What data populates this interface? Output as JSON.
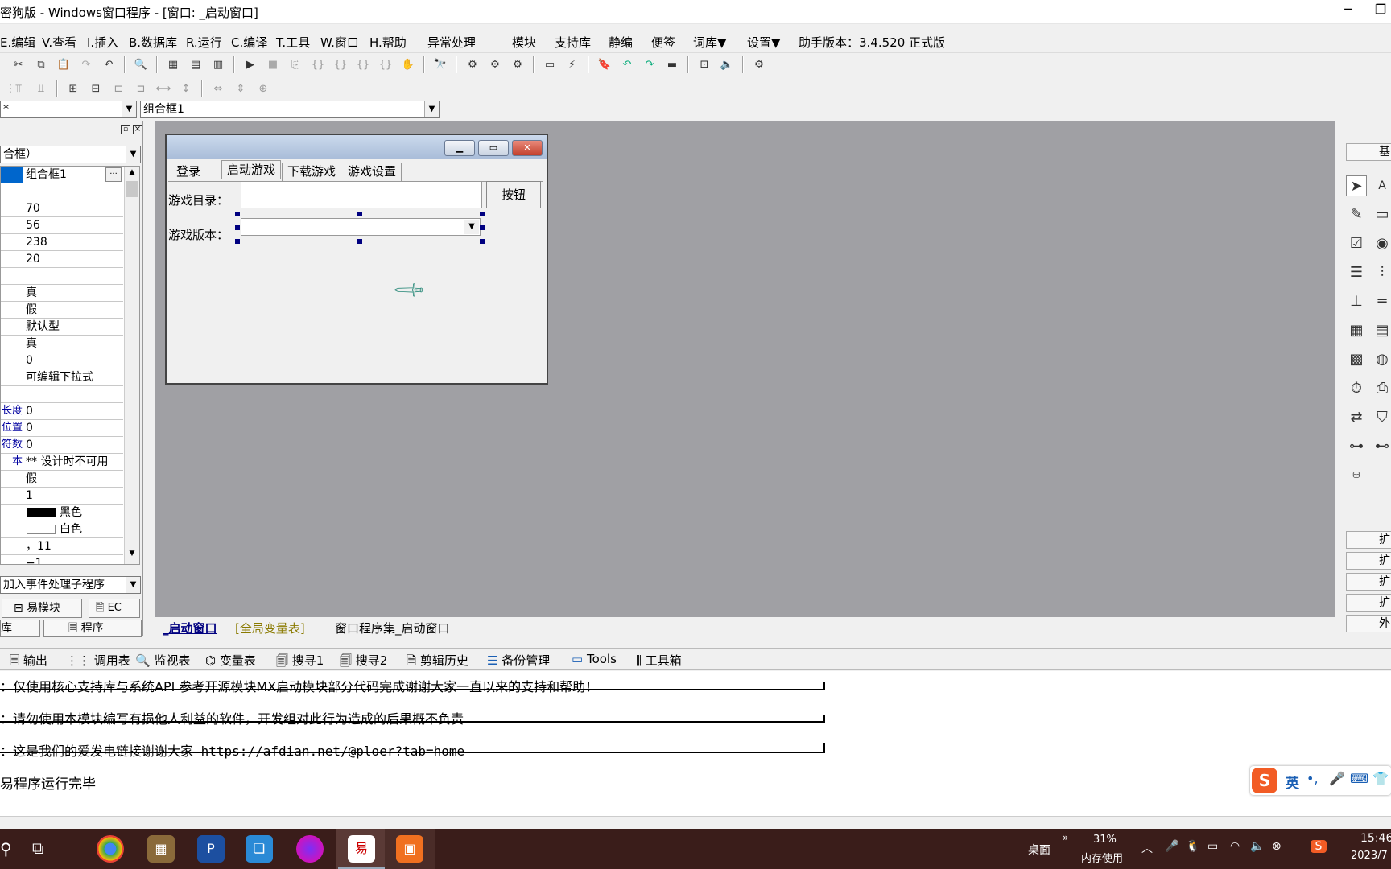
{
  "window": {
    "title": "密狗版 - Windows窗口程序 - [窗口: _启动窗口]",
    "min_icon": "minimize-icon",
    "max_icon": "restore-icon"
  },
  "menu": {
    "items": [
      "E.编辑",
      "V.查看",
      "I.插入",
      "B.数据库",
      "R.运行",
      "C.编译",
      "T.工具",
      "W.窗口",
      "H.帮助",
      "异常处理",
      "模块",
      "支持库",
      "静编",
      "便签",
      "词库▼",
      "设置▼"
    ],
    "version": "助手版本：3.4.520 正式版"
  },
  "toolbar": {
    "combo1": "*",
    "combo2": "组合框1"
  },
  "props": {
    "header": "合框）",
    "rows": [
      {
        "k": "",
        "v": "组合框1"
      },
      {
        "k": "",
        "v": ""
      },
      {
        "k": "",
        "v": "70"
      },
      {
        "k": "",
        "v": "56"
      },
      {
        "k": "",
        "v": "238"
      },
      {
        "k": "",
        "v": "20"
      },
      {
        "k": "",
        "v": ""
      },
      {
        "k": "",
        "v": "真"
      },
      {
        "k": "",
        "v": "假"
      },
      {
        "k": "",
        "v": "默认型"
      },
      {
        "k": "",
        "v": "真"
      },
      {
        "k": "",
        "v": "0"
      },
      {
        "k": "",
        "v": "可编辑下拉式"
      },
      {
        "k": "",
        "v": ""
      },
      {
        "k": "长度",
        "v": "0"
      },
      {
        "k": "位置",
        "v": "0"
      },
      {
        "k": "符数",
        "v": "0"
      },
      {
        "k": "本",
        "v": "** 设计时不可用"
      },
      {
        "k": "",
        "v": "假"
      },
      {
        "k": "",
        "v": "1"
      },
      {
        "k": "",
        "v": "黑色"
      },
      {
        "k": "",
        "v": "白色"
      },
      {
        "k": "",
        "v": "，11"
      },
      {
        "k": "",
        "v": "−1"
      }
    ],
    "event_combo": "加入事件处理子程序",
    "tab_modules": "易模块",
    "tab_ec": "EC",
    "tab_lib": "库",
    "tab_program": "程序"
  },
  "form": {
    "tabs": [
      "登录",
      "启动游戏",
      "下载游戏",
      "游戏设置"
    ],
    "label_dir": "游戏目录：",
    "label_ver": "游戏版本：",
    "button": "按钮"
  },
  "right": {
    "top_label": "基",
    "tabs": [
      "扩",
      "扩",
      "扩",
      "扩",
      "外"
    ]
  },
  "doc_tabs": [
    "_启动窗口",
    "[全局变量表]",
    "窗口程序集_启动窗口"
  ],
  "bottom_tabs": [
    "输出",
    "调用表",
    "监视表",
    "变量表",
    "搜寻1",
    "搜寻2",
    "剪辑历史",
    "备份管理",
    "Tools",
    "工具箱"
  ],
  "output": {
    "lines": [
      "：仅使用核心支持库与系统API 参考开源模块MX启动模块部分代码完成谢谢大家一直以来的支持和帮助！",
      "：请勿使用本模块编写有损他人利益的软件，开发组对此行为造成的后果概不负责",
      "：这是我们的爱发电链接谢谢大家  https://afdian.net/@ploer?tab=home"
    ],
    "status": "易程序运行完毕"
  },
  "ime": {
    "lang": "英"
  },
  "taskbar": {
    "desktop": "桌面",
    "mem_pct": "31%",
    "mem_label": "内存使用",
    "time": "15:46",
    "date": "2023/7"
  }
}
